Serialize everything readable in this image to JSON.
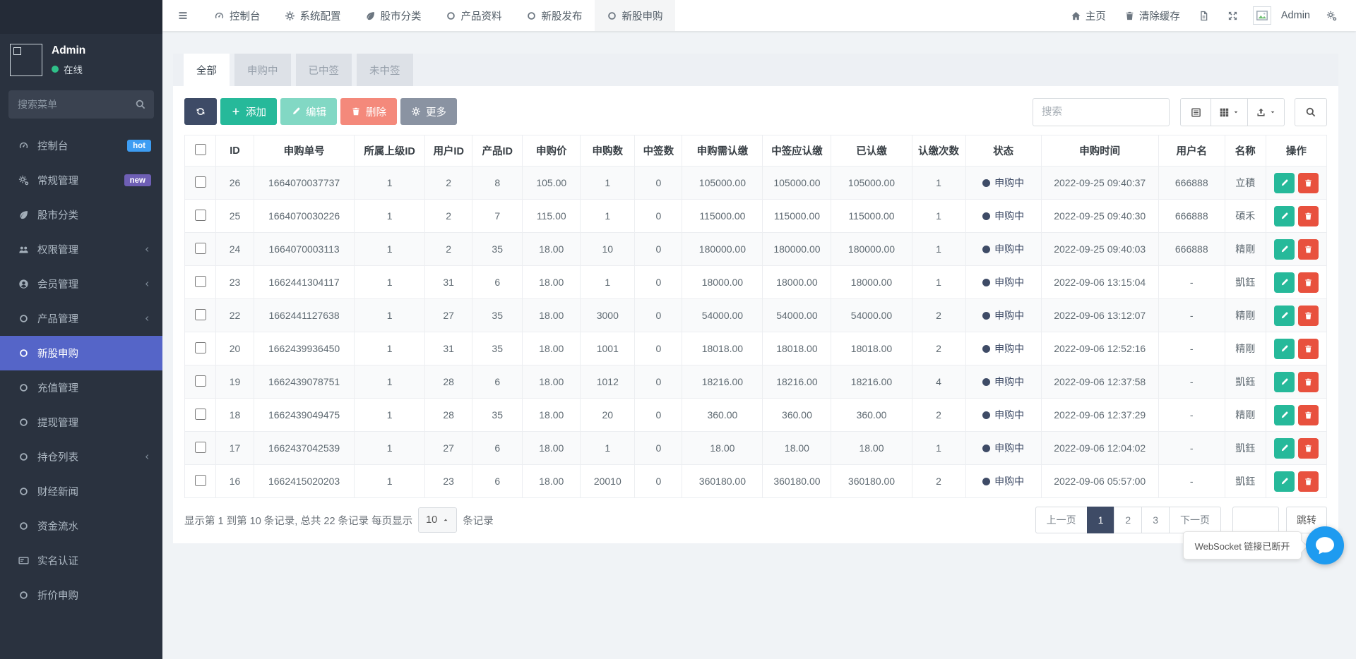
{
  "colors": {
    "primary": "#5565c8",
    "success": "#26b99a",
    "danger": "#e8513e",
    "dark": "#3e4b66",
    "hot_badge": "#3d9df3",
    "new_badge": "#6e5fb5",
    "online": "#2fc089",
    "chat": "#1e9bf0"
  },
  "sidebar": {
    "username": "Admin",
    "status": "在线",
    "search_placeholder": "搜索菜单",
    "items": [
      {
        "label": "控制台",
        "icon": "dashboard",
        "badge": "hot",
        "badge_color": "#3d9df3"
      },
      {
        "label": "常规管理",
        "icon": "gears",
        "badge": "new",
        "badge_color": "#6e5fb5"
      },
      {
        "label": "股市分类",
        "icon": "leaf"
      },
      {
        "label": "权限管理",
        "icon": "users",
        "expandable": true
      },
      {
        "label": "会员管理",
        "icon": "user-circle",
        "expandable": true
      },
      {
        "label": "产品管理",
        "icon": "circle",
        "expandable": true
      },
      {
        "label": "新股申购",
        "icon": "circle",
        "active": true
      },
      {
        "label": "充值管理",
        "icon": "circle"
      },
      {
        "label": "提现管理",
        "icon": "circle"
      },
      {
        "label": "持仓列表",
        "icon": "circle",
        "expandable": true
      },
      {
        "label": "财经新闻",
        "icon": "circle"
      },
      {
        "label": "资金流水",
        "icon": "circle"
      },
      {
        "label": "实名认证",
        "icon": "id-card"
      },
      {
        "label": "折价申购",
        "icon": "circle"
      }
    ]
  },
  "topnav": {
    "items": [
      {
        "label": "控制台",
        "icon": "dashboard"
      },
      {
        "label": "系统配置",
        "icon": "gear"
      },
      {
        "label": "股市分类",
        "icon": "leaf"
      },
      {
        "label": "产品资料",
        "icon": "circle"
      },
      {
        "label": "新股发布",
        "icon": "circle"
      },
      {
        "label": "新股申购",
        "icon": "circle",
        "active": true
      }
    ],
    "home_label": "主页",
    "clear_cache_label": "清除缓存",
    "username": "Admin"
  },
  "tabs": [
    {
      "label": "全部",
      "active": true
    },
    {
      "label": "申购中"
    },
    {
      "label": "已中签"
    },
    {
      "label": "未中签"
    }
  ],
  "toolbar": {
    "add_label": "添加",
    "edit_label": "编辑",
    "delete_label": "删除",
    "more_label": "更多",
    "search_placeholder": "搜索"
  },
  "table": {
    "headers": [
      "ID",
      "申购单号",
      "所属上级ID",
      "用户ID",
      "产品ID",
      "申购价",
      "申购数",
      "中签数",
      "申购需认缴",
      "中签应认缴",
      "已认缴",
      "认缴次数",
      "状态",
      "申购时间",
      "用户名",
      "名称",
      "操作"
    ],
    "rows": [
      [
        "26",
        "1664070037737",
        "1",
        "2",
        "8",
        "105.00",
        "1",
        "0",
        "105000.00",
        "105000.00",
        "105000.00",
        "1",
        "申购中",
        "2022-09-25 09:40:37",
        "666888",
        "立積"
      ],
      [
        "25",
        "1664070030226",
        "1",
        "2",
        "7",
        "115.00",
        "1",
        "0",
        "115000.00",
        "115000.00",
        "115000.00",
        "1",
        "申购中",
        "2022-09-25 09:40:30",
        "666888",
        "碩禾"
      ],
      [
        "24",
        "1664070003113",
        "1",
        "2",
        "35",
        "18.00",
        "10",
        "0",
        "180000.00",
        "180000.00",
        "180000.00",
        "1",
        "申购中",
        "2022-09-25 09:40:03",
        "666888",
        "精剛"
      ],
      [
        "23",
        "1662441304117",
        "1",
        "31",
        "6",
        "18.00",
        "1",
        "0",
        "18000.00",
        "18000.00",
        "18000.00",
        "1",
        "申购中",
        "2022-09-06 13:15:04",
        "-",
        "凱鈺"
      ],
      [
        "22",
        "1662441127638",
        "1",
        "27",
        "35",
        "18.00",
        "3000",
        "0",
        "54000.00",
        "54000.00",
        "54000.00",
        "2",
        "申购中",
        "2022-09-06 13:12:07",
        "-",
        "精剛"
      ],
      [
        "20",
        "1662439936450",
        "1",
        "31",
        "35",
        "18.00",
        "1001",
        "0",
        "18018.00",
        "18018.00",
        "18018.00",
        "2",
        "申购中",
        "2022-09-06 12:52:16",
        "-",
        "精剛"
      ],
      [
        "19",
        "1662439078751",
        "1",
        "28",
        "6",
        "18.00",
        "1012",
        "0",
        "18216.00",
        "18216.00",
        "18216.00",
        "4",
        "申购中",
        "2022-09-06 12:37:58",
        "-",
        "凱鈺"
      ],
      [
        "18",
        "1662439049475",
        "1",
        "28",
        "35",
        "18.00",
        "20",
        "0",
        "360.00",
        "360.00",
        "360.00",
        "2",
        "申购中",
        "2022-09-06 12:37:29",
        "-",
        "精剛"
      ],
      [
        "17",
        "1662437042539",
        "1",
        "27",
        "6",
        "18.00",
        "1",
        "0",
        "18.00",
        "18.00",
        "18.00",
        "1",
        "申购中",
        "2022-09-06 12:04:02",
        "-",
        "凱鈺"
      ],
      [
        "16",
        "1662415020203",
        "1",
        "23",
        "6",
        "18.00",
        "20010",
        "0",
        "360180.00",
        "360180.00",
        "360180.00",
        "2",
        "申购中",
        "2022-09-06 05:57:00",
        "-",
        "凱鈺"
      ]
    ]
  },
  "pagination": {
    "summary_prefix": "显示第 1 到第 10 条记录, 总共 22 条记录 每页显示",
    "page_size": "10",
    "summary_suffix": "条记录",
    "prev_label": "上一页",
    "next_label": "下一页",
    "pages": [
      "1",
      "2",
      "3"
    ],
    "active_page": "1",
    "jump_label": "跳转"
  },
  "chat": {
    "tooltip": "WebSocket 链接已断开"
  }
}
